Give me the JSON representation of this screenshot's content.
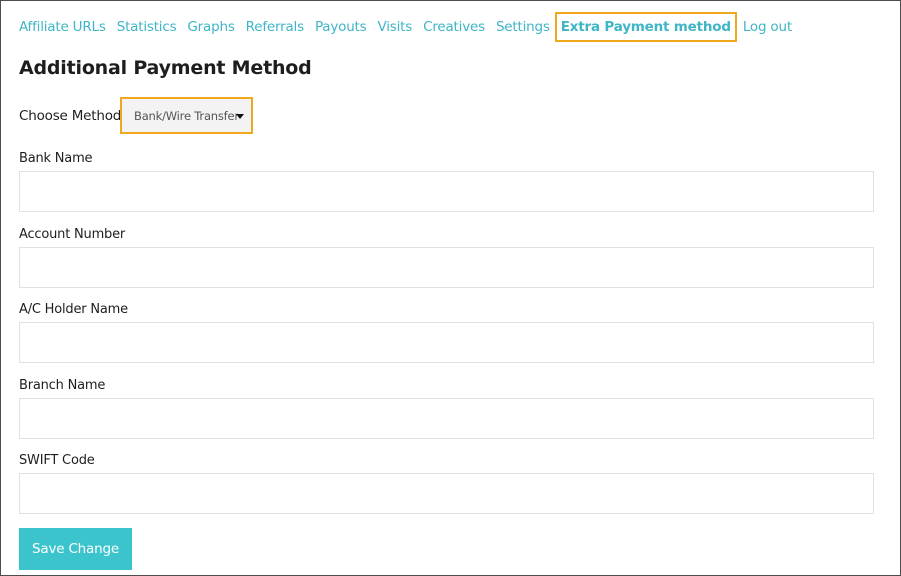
{
  "nav": {
    "items": [
      {
        "label": "Affiliate URLs"
      },
      {
        "label": "Statistics"
      },
      {
        "label": "Graphs"
      },
      {
        "label": "Referrals"
      },
      {
        "label": "Payouts"
      },
      {
        "label": "Visits"
      },
      {
        "label": "Creatives"
      },
      {
        "label": "Settings"
      },
      {
        "label": "Extra Payment method",
        "active": true
      },
      {
        "label": "Log out"
      }
    ]
  },
  "page": {
    "title": "Additional Payment Method"
  },
  "method": {
    "label": "Choose Method",
    "selected": "Bank/Wire Transfer"
  },
  "fields": [
    {
      "label": "Bank Name",
      "value": ""
    },
    {
      "label": "Account Number",
      "value": ""
    },
    {
      "label": "A/C Holder Name",
      "value": ""
    },
    {
      "label": "Branch Name",
      "value": ""
    },
    {
      "label": "SWIFT Code",
      "value": ""
    }
  ],
  "actions": {
    "save_label": "Save Change"
  },
  "colors": {
    "link": "#3fb5c6",
    "highlight": "#f0a81c",
    "button": "#3cc4cc"
  }
}
